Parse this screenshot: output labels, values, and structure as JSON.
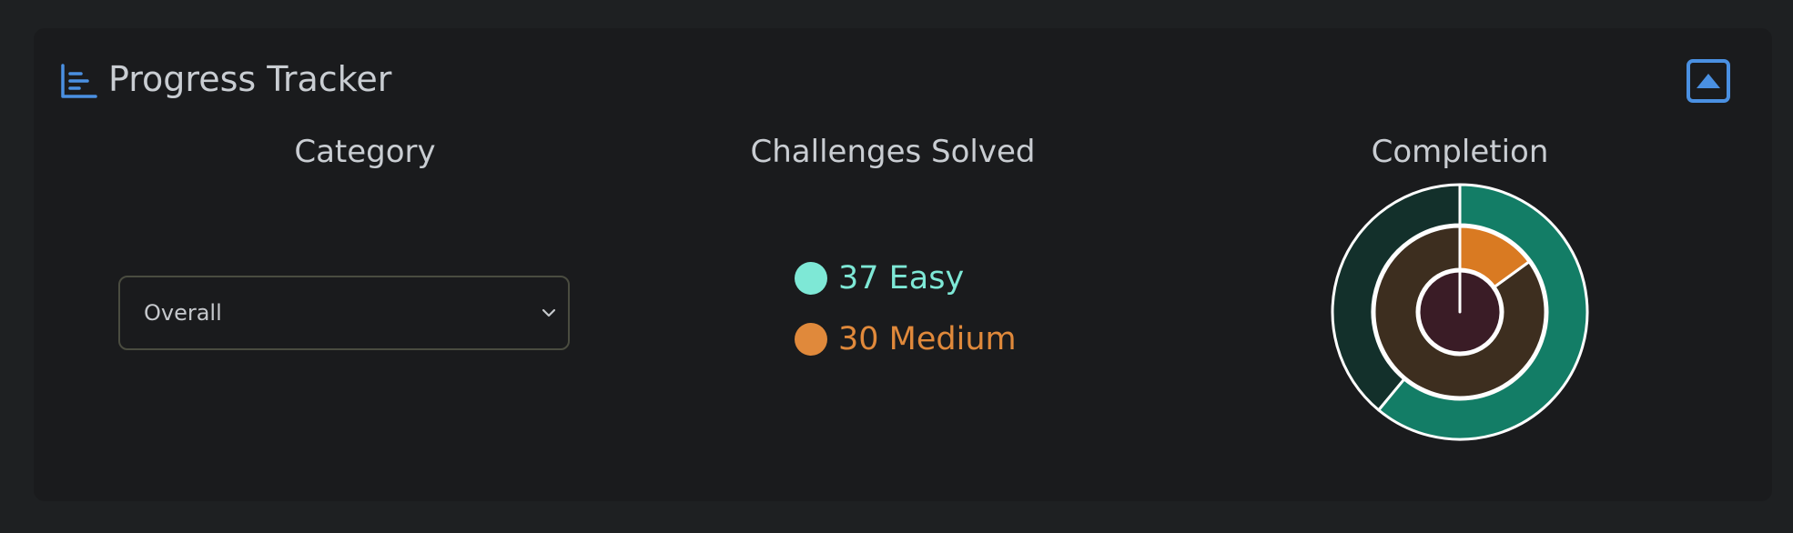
{
  "header": {
    "title": "Progress Tracker",
    "icon": "bar-chart-icon",
    "collapse_icon": "collapse-up-icon"
  },
  "columns": {
    "category_title": "Category",
    "solved_title": "Challenges Solved",
    "completion_title": "Completion"
  },
  "category_select": {
    "value": "Overall",
    "icon": "chevron-down-icon"
  },
  "solved": [
    {
      "count": "37",
      "label": "Easy",
      "text": "37 Easy",
      "color": "#7ee8d6"
    },
    {
      "count": "30",
      "label": "Medium",
      "text": "30 Medium",
      "color": "#e0893b"
    }
  ],
  "completion": {
    "outer_fraction": 0.61,
    "middle_fraction": 0.15,
    "inner_fraction": 0.0,
    "colors": {
      "outer_fill": "#137d66",
      "outer_track": "#13302b",
      "middle_fill": "#d97a22",
      "middle_track": "#3d2e1f",
      "inner_track": "#3a1c26"
    }
  },
  "theme": {
    "accent": "#4a90e2",
    "background": "#1e2022",
    "card": "#1a1b1d"
  }
}
